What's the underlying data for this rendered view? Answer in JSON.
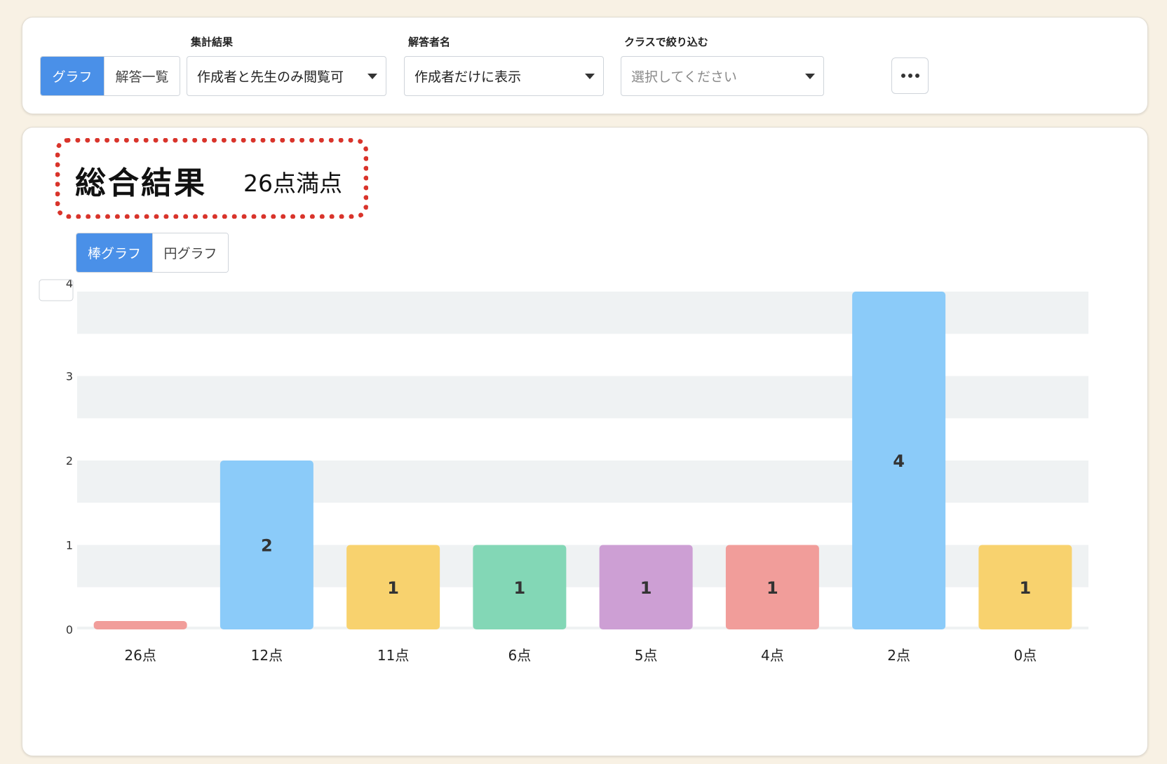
{
  "toolbar": {
    "view_graph_label": "グラフ",
    "view_list_label": "解答一覧",
    "aggregate_label": "集計結果",
    "aggregate_value": "作成者と先生のみ閲覧可",
    "respondent_label": "解答者名",
    "respondent_value": "作成者だけに表示",
    "class_filter_label": "クラスで絞り込む",
    "class_filter_placeholder": "選択してください",
    "more_icon": "more-horizontal-icon"
  },
  "result": {
    "title": "総合結果",
    "score": "26点満点",
    "bar_toggle_label": "棒グラフ",
    "pie_toggle_label": "円グラフ"
  },
  "chart_data": {
    "type": "bar",
    "categories": [
      "26点",
      "12点",
      "11点",
      "6点",
      "5点",
      "4点",
      "2点",
      "0点"
    ],
    "values": [
      0,
      2,
      1,
      1,
      1,
      1,
      4,
      1
    ],
    "value_labels": [
      "",
      "2",
      "1",
      "1",
      "1",
      "1",
      "4",
      "1"
    ],
    "colors": [
      "#f19d9a",
      "#8bcbf9",
      "#f8d26e",
      "#83d7b6",
      "#cd9fd4",
      "#f19d9a",
      "#8bcbf9",
      "#f8d26e"
    ],
    "y_ticks": [
      "0",
      "1",
      "2",
      "3",
      "4"
    ],
    "ylim": [
      0,
      4
    ],
    "grid": true,
    "title": "",
    "xlabel": "",
    "ylabel": ""
  }
}
